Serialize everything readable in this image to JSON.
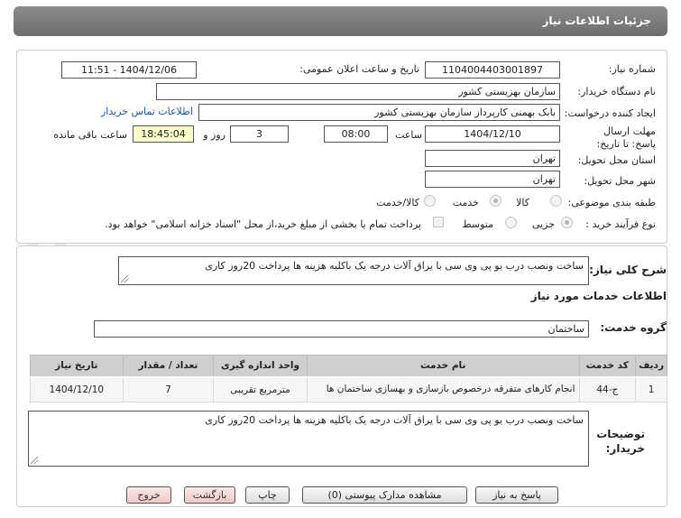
{
  "header": {
    "title": "جزئیات اطلاعات نیاز"
  },
  "form": {
    "need_number_label": "شماره نیاز:",
    "need_number": "1104004403001897",
    "announce_label": "تاریخ و ساعت اعلان عمومی:",
    "announce_value": "1404/12/06 - 11:51",
    "buyer_org_label": "نام دستگاه خریدار:",
    "buyer_org": "سازمان بهزیستی کشور",
    "creator_label": "ایجاد کننده درخواست:",
    "creator": "بابک بهمنی کارپرداز سازمان بهزیستی کشور",
    "contact_link": "اطلاعات تماس خریدار",
    "deadline_label": "مهلت ارسال پاسخ: تا تاریخ:",
    "deadline_date": "1404/12/10",
    "time_label": "ساعت",
    "deadline_time": "08:00",
    "days": "3",
    "days_label": "روز و",
    "remaining_time": "18:45:04",
    "remaining_label": "ساعت باقی مانده",
    "province_label": "استان محل تحویل:",
    "province": "تهران",
    "city_label": "شهر محل تحویل:",
    "city": "تهران",
    "category_label": "طبقه بندی موضوعی:",
    "category_options": [
      "کالا",
      "خدمت",
      "کالا/خدمت"
    ],
    "process_label": "نوع فرآیند خرید :",
    "process_options": [
      "جزیی",
      "متوسط"
    ],
    "payment_note": "پرداخت تمام یا بخشی از مبلغ خرید،از محل \"اسناد خزانه اسلامی\" خواهد بود."
  },
  "details": {
    "summary_label": "شرح کلی نیاز:",
    "summary": "ساخت ونصب درب یو پی وی سی با یراق آلات درجه یک باکلیه هزینه ها پرداخت 20روز کاری",
    "services_heading": "اطلاعات خدمات مورد نیاز",
    "service_group_label": "گروه خدمت:",
    "service_group": "ساختمان",
    "table": {
      "headers": [
        "ردیف",
        "کد خدمت",
        "نام خدمت",
        "واحد اندازه گیری",
        "تعداد / مقدار",
        "تاریخ نیاز"
      ],
      "rows": [
        [
          "1",
          "ج-44",
          "انجام کارهای متفرقه درخصوص بازسازی و بهسازی ساختمان ها",
          "مترمربع تقریبی",
          "7",
          "1404/12/10"
        ]
      ]
    },
    "buyer_notes_label": "توضیحات خریدار:",
    "buyer_notes": "ساخت ونصب درب یو پی وی سی با یراق آلات درجه یک باکلیه هزینه ها پرداخت 20روز کاری"
  },
  "buttons": {
    "respond": "پاسخ به نیاز",
    "attachments": "مشاهده مدارک پیوستی (0)",
    "print": "چاپ",
    "back": "بازگشت",
    "exit": "خروج"
  },
  "watermark": {
    "text": "AriaTender.net"
  },
  "colors": {
    "header": "#7a7a7a",
    "link": "#1a55c4",
    "remaining_bg": "#ffffcc",
    "exit_bg": "#f3d3d3",
    "watermark": "#f3dede"
  }
}
